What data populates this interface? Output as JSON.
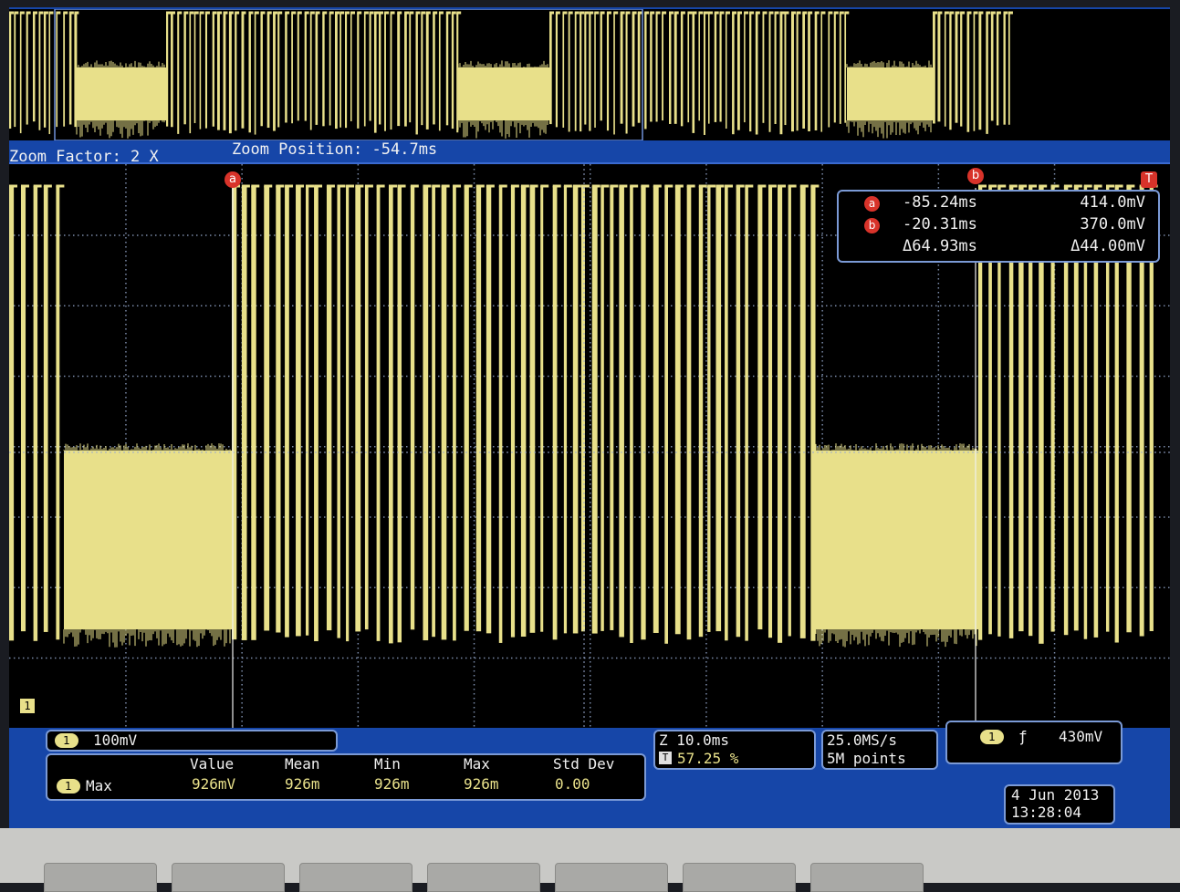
{
  "zoom": {
    "factor_label": "Zoom Factor: 2 X",
    "position_label": "Zoom Position: -54.7ms"
  },
  "cursors": {
    "a_label": "a",
    "b_label": "b",
    "trigger_label": "T"
  },
  "readout": {
    "a_time": "-85.24ms",
    "a_volt": "414.0mV",
    "b_time": "-20.31ms",
    "b_volt": "370.0mV",
    "delta_time": "Δ64.93ms",
    "delta_volt": "Δ44.00mV"
  },
  "channel": {
    "number": "1",
    "scale": "100mV"
  },
  "measurement": {
    "name": "Max",
    "headers": [
      "Value",
      "Mean",
      "Min",
      "Max",
      "Std Dev"
    ],
    "values": [
      "926mV",
      "926m",
      "926m",
      "926m",
      "0.00"
    ]
  },
  "timebase": {
    "zoom_label": "Z 10.0ms",
    "trigger_pos_icon": "T",
    "trigger_pos": "57.25 %"
  },
  "acquisition": {
    "rate": "25.0MS/s",
    "record": "5M points"
  },
  "trigger": {
    "slope_icon": "rising-edge-icon",
    "slope_glyph": "ƒ",
    "level": "430mV"
  },
  "timestamp": {
    "date": "4 Jun 2013",
    "time": "13:28:04"
  },
  "colors": {
    "screen_blue": "#1646a8",
    "trace": "#e8e08a",
    "cursor_marker": "#d8332a",
    "panel_border": "#7b9ad6"
  }
}
